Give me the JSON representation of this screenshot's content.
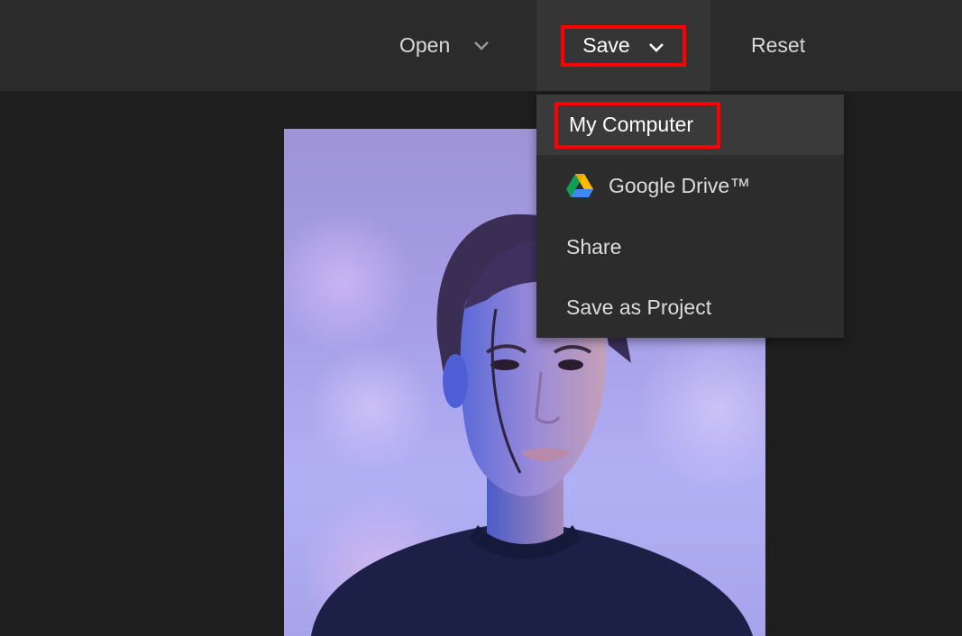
{
  "toolbar": {
    "open_label": "Open",
    "save_label": "Save",
    "reset_label": "Reset"
  },
  "save_menu": {
    "items": [
      {
        "label": "My Computer",
        "icon": null,
        "highlighted": true
      },
      {
        "label": "Google Drive™",
        "icon": "google-drive-icon"
      },
      {
        "label": "Share",
        "icon": null
      },
      {
        "label": "Save as Project",
        "icon": null
      }
    ]
  },
  "canvas": {
    "content": "portrait-photo"
  },
  "colors": {
    "highlight_box": "#ff0000",
    "topbar_bg": "#2b2b2b",
    "workspace_bg": "#1e1e1e",
    "dropdown_bg": "#2c2c2c"
  }
}
